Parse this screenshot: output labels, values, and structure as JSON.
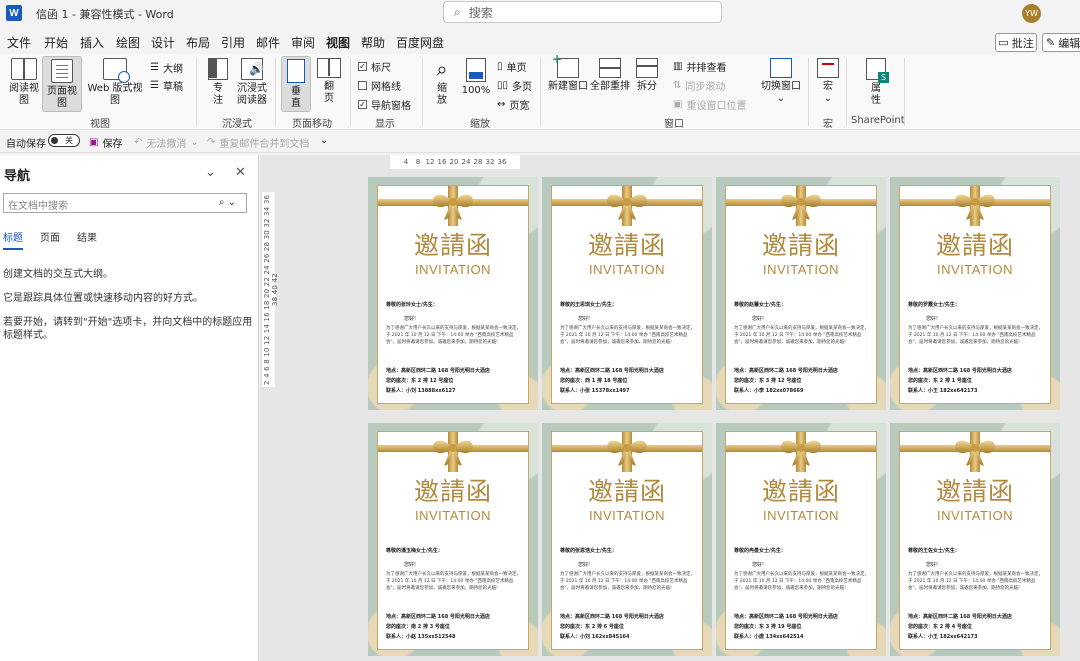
{
  "app": {
    "logo_letter": "W",
    "title": "信函 1  -  兼容性模式  -  Word",
    "search_placeholder": "搜索",
    "avatar_initials": "YW"
  },
  "menu": {
    "tabs": [
      "文件",
      "开始",
      "插入",
      "绘图",
      "设计",
      "布局",
      "引用",
      "邮件",
      "审阅",
      "视图",
      "帮助",
      "百度网盘"
    ],
    "active": "视图",
    "comment_label": "批注",
    "edit_label": "编辑"
  },
  "ribbon": {
    "view_group": {
      "read": "阅读视图",
      "page": "页面视图",
      "web": "Web 版式视图",
      "outline": "大纲",
      "draft": "草稿",
      "label": "视图"
    },
    "immersive_group": {
      "focus": "专注",
      "reader": "沉浸式阅读器",
      "label": "沉浸式"
    },
    "page_move_group": {
      "vertical": "垂直",
      "flip": "翻页",
      "label": "页面移动"
    },
    "show_group": {
      "ruler": "标尺",
      "gridlines": "网格线",
      "navpane": "导航窗格",
      "ruler_checked": true,
      "gridlines_checked": false,
      "navpane_checked": true,
      "label": "显示"
    },
    "zoom_group": {
      "zoom": "缩放",
      "percent": "100%",
      "one_page": "单页",
      "multi_page": "多页",
      "page_width": "页宽",
      "label": "缩放"
    },
    "window_group": {
      "new_window": "新建窗口",
      "arrange_all": "全部重排",
      "split": "拆分",
      "side_by_side": "并排查看",
      "sync_scroll": "同步滚动",
      "reset_position": "重设窗口位置",
      "switch": "切换窗口",
      "label": "窗口"
    },
    "macro_group": {
      "macro": "宏",
      "label": "宏"
    },
    "sharepoint_group": {
      "properties": "属性",
      "label": "SharePoint"
    }
  },
  "qat": {
    "autosave": "自动保存",
    "toggle_state": "关",
    "save": "保存",
    "undo": "无法撤消",
    "redo": "重复邮件合并到文档"
  },
  "nav": {
    "title": "导航",
    "search_placeholder": "在文档中搜索",
    "tabs": [
      "标题",
      "页面",
      "结果"
    ],
    "active_tab": "标题",
    "text1": "创建文档的交互式大纲。",
    "text2": "它是跟踪具体位置或快速移动内容的好方式。",
    "text3": "若要开始，请转到\"开始\"选项卡，并向文档中的标题应用标题样式。"
  },
  "ruler": {
    "h_ticks": [
      "4",
      "8",
      "12",
      "16",
      "20",
      "24",
      "28",
      "32",
      "36"
    ],
    "v_ticks": "2 4 6 8 10 12 14 16 18 20 22 24 26 28 30 32 34 36 38 40 42"
  },
  "invitation": {
    "title_cn": "邀請函",
    "title_en": "INVITATION",
    "greeting": "您好!",
    "body": "为了感谢广大用户长久以来的支持与厚爱，根据某某商会一致决定，于 2021 年 10 月 12 日 下午：14:00 举办 \"西南高校艺术精品会\"，届时将邀请您参加，诚邀您来参加，期待您的光临!",
    "location": "地点：高新区西环二路 168 号阳光明日大酒店"
  },
  "pages": [
    {
      "recipient": "尊敬的张玲女士/先生：",
      "seat": "您的座次：东 2 排 12 号座位",
      "contact": "联系人：小刘 13888xx6127"
    },
    {
      "recipient": "尊敬的王思琪女士/先生：",
      "seat": "您的座次：西 1 排 18 号座位",
      "contact": "联系人：小张 15378xx1497"
    },
    {
      "recipient": "尊敬的赵蕾女士/先生：",
      "seat": "您的座次：东 3 排 12 号座位",
      "contact": "联系人：小李 182xx078669"
    },
    {
      "recipient": "尊敬的罗霞女士/先生：",
      "seat": "您的座次：东 2 排 1 号座位",
      "contact": "联系人：小王 182xx642173"
    },
    {
      "recipient": "尊敬的潘玉梅女士/先生：",
      "seat": "您的座次：南 2 排 3 号座位",
      "contact": "联系人：小赵 135xx512548"
    },
    {
      "recipient": "尊敬的张恩浩女士/先生：",
      "seat": "您的座次：东 2 排 6 号座位",
      "contact": "联系人：小刘 162xx845164"
    },
    {
      "recipient": "尊敬的冉曼女士/先生：",
      "seat": "您的座次：东 3 排 19 号座位",
      "contact": "联系人：小唐 134xx642514"
    },
    {
      "recipient": "尊敬的王佐女士/先生：",
      "seat": "您的座次：东 2 排 4 号座位",
      "contact": "联系人：小王 182xx642173"
    }
  ]
}
